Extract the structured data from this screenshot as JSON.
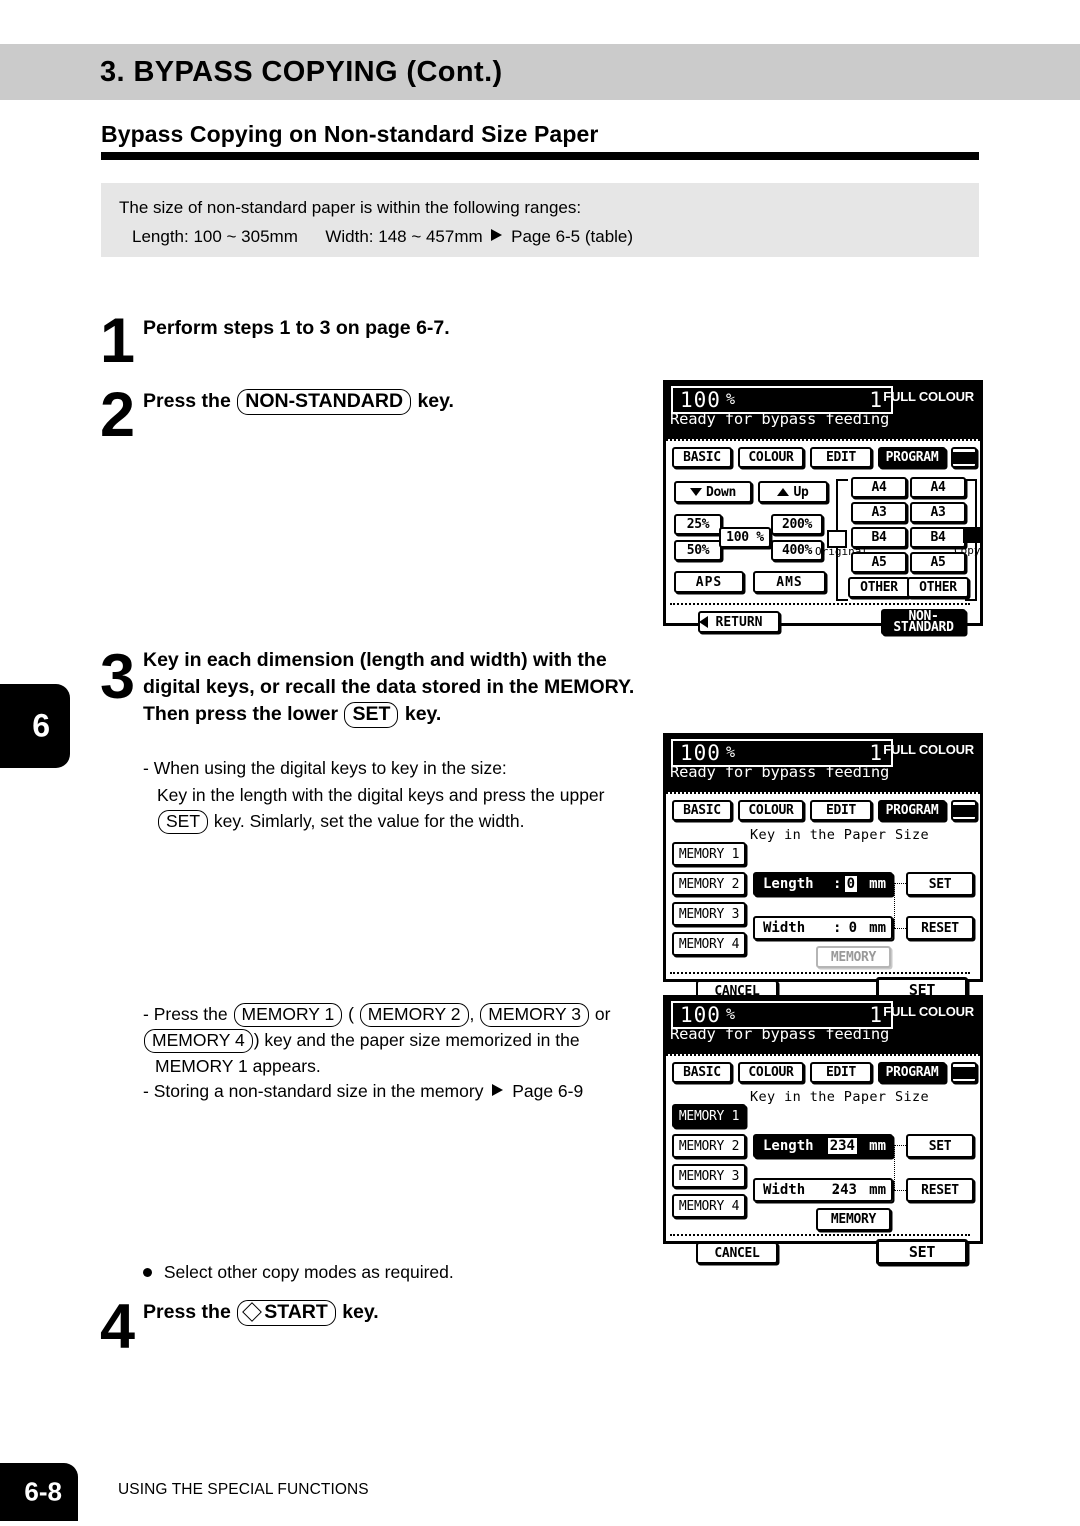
{
  "header": {
    "chapter_title": "3. BYPASS COPYING (Cont.)",
    "section_title": "Bypass Copying on Non-standard Size Paper"
  },
  "infobox": {
    "line1": "The size of non-standard paper is within the following ranges:",
    "length": "Length: 100 ~ 305mm",
    "width": "Width: 148 ~ 457mm",
    "ref": "Page 6-5 (table)"
  },
  "steps": {
    "s1": {
      "num": "1",
      "text": "Perform steps 1 to 3 on page 6-7."
    },
    "s2": {
      "num": "2",
      "pre": "Press the",
      "key": "NON-STANDARD",
      "post": "key."
    },
    "s3": {
      "num": "3",
      "line1": "Key in each dimension (length and width) with the",
      "line2": "digital keys, or recall the data stored in the MEMORY.",
      "line3_pre": "Then press the lower",
      "line3_key": "SET",
      "line3_post": "key.",
      "note1": "- When using the digital keys to key in the size:",
      "note2_a": "Key in the length with the digital keys and press the upper",
      "note2_b_key": "SET",
      "note2_b": "key.  Simlarly, set the value for the width."
    },
    "s4": {
      "num": "4",
      "pre": "Press the",
      "key": "START",
      "post": "key."
    }
  },
  "memory_note": {
    "l1_a": "- Press the",
    "k1": "MEMORY 1",
    "l1_b": "(",
    "k2": "MEMORY 2",
    "l1_c": ",",
    "k3": "MEMORY 3",
    "l1_d": "or",
    "k4": "MEMORY 4",
    "l2": ") key and the paper size memorized in the",
    "l3": "MEMORY 1 appears.",
    "l4": "- Storing a non-standard size in the memory",
    "l4_ref": "Page 6-9"
  },
  "select_other": "Select other copy modes as required.",
  "side_tab": {
    "chapter": "6"
  },
  "footer": {
    "page": "6-8",
    "text": "USING THE SPECIAL FUNCTIONS"
  },
  "lcd_common": {
    "ratio": "100",
    "percent": "%",
    "copy_count": "1",
    "colour_mode": "FULL COLOUR",
    "status": "Ready for bypass feeding",
    "tabs": {
      "basic": "BASIC",
      "colour": "COLOUR",
      "edit": "EDIT",
      "program": "PROGRAM",
      "keyboard": "keyboard-icon"
    }
  },
  "panel1": {
    "down": "Down",
    "up": "Up",
    "z25": "25%",
    "z50": "50%",
    "z100": "100 %",
    "z200": "200%",
    "z400": "400%",
    "aps": "APS",
    "ams": "AMS",
    "original_label": "Original",
    "copy_label": "Copy",
    "orig_sizes": [
      "A4",
      "A3",
      "B4",
      "A5",
      "OTHER"
    ],
    "copy_sizes": [
      "A4",
      "A3",
      "B4",
      "A5",
      "OTHER"
    ],
    "return": "RETURN",
    "non_standard_l1": "NON-",
    "non_standard_l2": "STANDARD"
  },
  "panel2": {
    "prompt": "Key in the Paper Size",
    "memories": [
      "MEMORY 1",
      "MEMORY 2",
      "MEMORY 3",
      "MEMORY 4"
    ],
    "selected_memory": null,
    "length_label": "Length",
    "length_value": "0",
    "width_label": "Width",
    "width_value": "0",
    "unit": "mm",
    "colon": ":",
    "set_upper": "SET",
    "reset": "RESET",
    "memory_btn": "MEMORY",
    "memory_btn_enabled": false,
    "cancel": "CANCEL",
    "set_lower": "SET"
  },
  "panel3": {
    "prompt": "Key in the Paper Size",
    "memories": [
      "MEMORY 1",
      "MEMORY 2",
      "MEMORY 3",
      "MEMORY 4"
    ],
    "selected_memory": "MEMORY 1",
    "length_label": "Length",
    "length_value": "234",
    "width_label": "Width",
    "width_value": "243",
    "unit": "mm",
    "colon": ":",
    "set_upper": "SET",
    "reset": "RESET",
    "memory_btn": "MEMORY",
    "memory_btn_enabled": true,
    "cancel": "CANCEL",
    "set_lower": "SET"
  }
}
